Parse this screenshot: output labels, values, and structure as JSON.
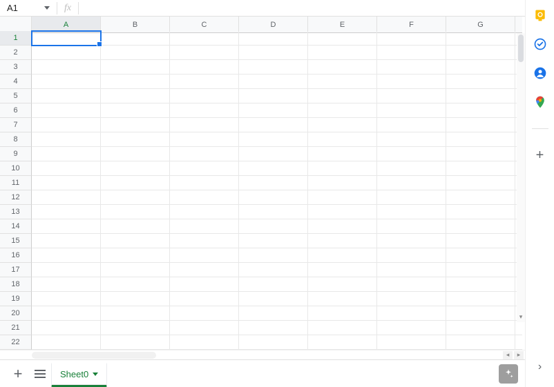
{
  "name_box": {
    "value": "A1"
  },
  "formula_bar": {
    "fx_label": "fx",
    "value": ""
  },
  "columns": [
    "A",
    "B",
    "C",
    "D",
    "E",
    "F",
    "G"
  ],
  "rows": [
    1,
    2,
    3,
    4,
    5,
    6,
    7,
    8,
    9,
    10,
    11,
    12,
    13,
    14,
    15,
    16,
    17,
    18,
    19,
    20,
    21,
    22
  ],
  "active_cell": {
    "col": "A",
    "row": 1
  },
  "sheet_tabs": {
    "add_label": "+",
    "active_index": 0,
    "items": [
      {
        "label": "Sheet0"
      }
    ]
  },
  "side_panel": {
    "icons": [
      {
        "name": "keep-icon"
      },
      {
        "name": "tasks-icon"
      },
      {
        "name": "contacts-icon"
      },
      {
        "name": "maps-icon"
      }
    ]
  }
}
